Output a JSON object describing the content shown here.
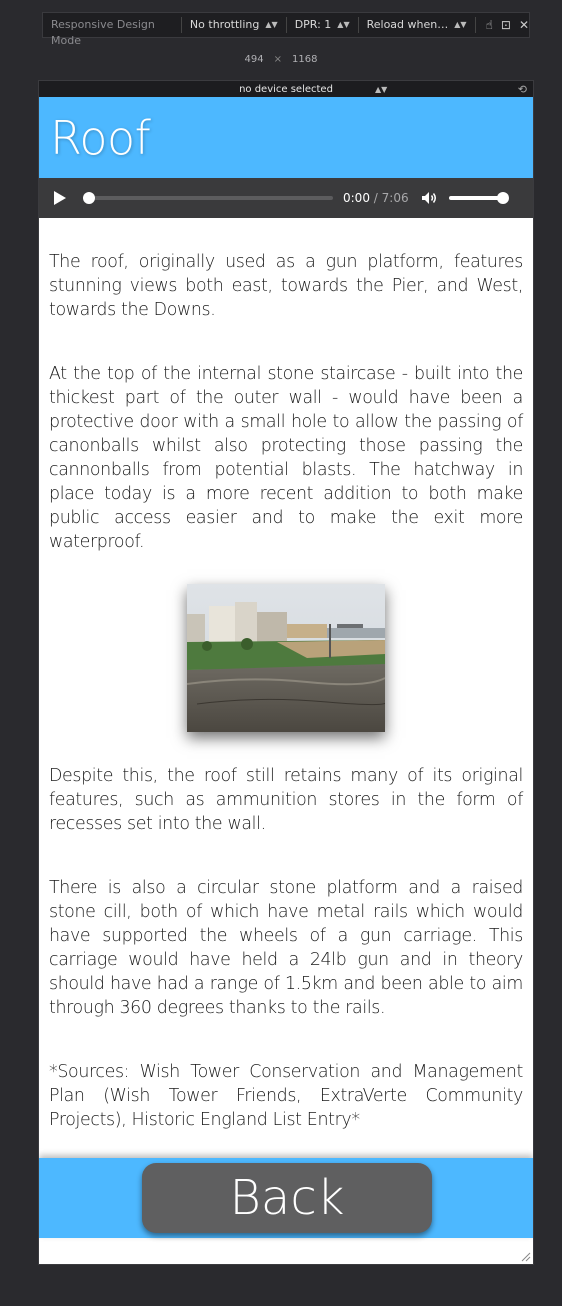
{
  "devtools": {
    "mode_label": "Responsive Design Mode",
    "throttling": "No throttling",
    "dpr": "DPR: 1",
    "reload": "Reload when…",
    "width": "494",
    "times": "×",
    "height": "1168",
    "device": "no device selected"
  },
  "page": {
    "title": "Roof",
    "audio": {
      "current": "0:00",
      "separator": "/",
      "duration": "7:06",
      "progress": 0.0,
      "volume": 1.0
    },
    "paragraphs": [
      "The roof, originally used as a gun platform, features stunning views both east, towards the Pier, and West, towards the Downs.",
      "At the top of the internal stone staircase - built into the thickest part of the outer wall - would have been a protective door with a small hole to allow the passing of canonballs whilst also protecting those passing the cannonballs from potential blasts. The hatchway in place today is a more recent addition to both make public access easier and to make the exit more waterproof.",
      "Despite this, the roof still retains many of its original features, such as ammunition stores in the form of recesses set into the wall.",
      "There is also a circular stone platform and a raised stone cill, both of which have metal rails which would have supported the wheels of a gun carriage. This carriage would have held a 24lb gun and in theory should have had a range of 1.5km and been able to aim through 360 degrees thanks to the rails.",
      "*Sources: Wish Tower Conservation and Management Plan (Wish Tower Friends, ExtraVerte Community Projects), Historic England List Entry*"
    ],
    "back_label": "Back"
  },
  "colors": {
    "header_blue": "#4db8ff",
    "player_bg": "#3a3a3c",
    "back_button": "#5f5f60"
  }
}
